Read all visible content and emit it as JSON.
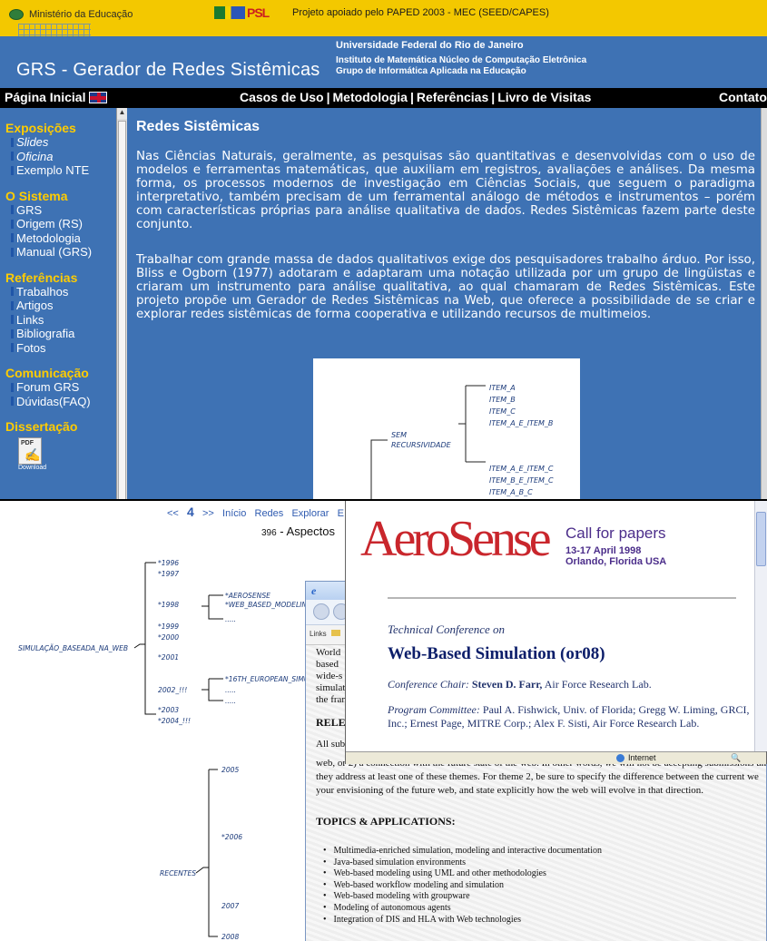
{
  "top": {
    "gov_left": "Ministério da Educação",
    "psl_logo": "PSL",
    "project": "Projeto apoiado pelo PAPED 2003 - MEC (SEED/CAPES)",
    "site_title": "GRS - Gerador de Redes Sistêmicas",
    "university": "Universidade Federal do Rio de Janeiro",
    "institute_line1": "Instituto de Matemática  Núcleo de Computação Eletrônica",
    "institute_line2": "Grupo de Informática Aplicada na Educação",
    "nav": {
      "home": "Página Inicial",
      "links": [
        "Casos de Uso",
        "Metodologia",
        "Referências",
        "Livro de Visitas"
      ],
      "contact": "Contato"
    },
    "sidebar": {
      "sections": [
        {
          "title": "Exposições",
          "items": [
            "Slides",
            "Oficina",
            "Exemplo NTE"
          ]
        },
        {
          "title": "O Sistema",
          "items": [
            "GRS",
            "Origem (RS)",
            "Metodologia",
            "Manual (GRS)"
          ]
        },
        {
          "title": "Referências",
          "items": [
            "Trabalhos",
            "Artigos",
            "Links",
            "Bibliografia",
            "Fotos"
          ]
        },
        {
          "title": "Comunicação",
          "items": [
            "Forum GRS",
            "Dúvidas(FAQ)"
          ]
        },
        {
          "title": "Dissertação",
          "items": []
        }
      ],
      "pdf_label": "PDF",
      "pdf_caption": "Download"
    },
    "content": {
      "heading": "Redes Sistêmicas",
      "para1": "Nas Ciências Naturais, geralmente, as pesquisas são quantitativas e desenvolvidas com o uso de modelos e ferramentas matemáticas, que auxiliam em registros, avaliações e análises.  Da mesma forma, os processos modernos de investigação em Ciências Sociais, que seguem o paradigma interpretativo, também precisam de um  ferramental análogo de métodos e instrumentos – porém com características próprias para análise qualitativa de dados.  Redes Sistêmicas  fazem parte deste conjunto.",
      "para2": "Trabalhar com grande massa de dados qualitativos exige dos pesquisadores trabalho árduo.  Por isso,  Bliss e Ogborn (1977) adotaram e adaptaram uma notação utilizada por um grupo de lingüistas e criaram um instrumento para análise qualitativa, ao qual chamaram de Redes Sistêmicas.  Este projeto propõe um Gerador de Redes Sistêmicas na Web, que oferece a possibilidade de se criar e explorar redes sistêmicas de forma cooperativa e utilizando recursos de multimeios.",
      "diagram": {
        "root": "SEM RECURSIVIDADE",
        "group1": [
          "ITEM_A",
          "ITEM_B",
          "ITEM_C",
          "ITEM_A_E_ITEM_B"
        ],
        "group2": [
          "ITEM_A_E_ITEM_C",
          "ITEM_B_E_ITEM_C",
          "ITEM_A_B_C"
        ]
      }
    }
  },
  "bottom": {
    "nav": {
      "prev": "<<",
      "page": "4",
      "next": ">>",
      "links": [
        "Início",
        "Redes",
        "Explorar",
        "E"
      ]
    },
    "aspect_page": "396",
    "aspect_title": "Aspectos",
    "tree": {
      "root": "SIMULAÇÃO_BASEADA_NA_WEB",
      "years": [
        "*1996",
        "*1997",
        "*1998",
        "*1999",
        "*2000",
        "*2001",
        "2002_!!!",
        "*2003",
        "*2004_!!!"
      ],
      "sub1998": [
        "*AEROSENSE",
        "*WEB_BASED_MODELIN",
        "....."
      ],
      "sub2002": [
        "*16TH_EUROPEAN_SIMU",
        ".....",
        "....."
      ],
      "recent_label": "RECENTES",
      "recent_years": [
        "2005",
        "*2006",
        "2007",
        "2008"
      ]
    },
    "ie_window": {
      "links_label": "Links",
      "text_frag": [
        "World",
        "based",
        "wide-s",
        "simulat",
        "the fran"
      ],
      "heading_rel": "RELE",
      "all_sub": "All sub",
      "paragraph": "web, or 2) a connection with the future state of the web. In other words, we will not be accepting submissions un they address at least one of these themes. For theme 2, be sure to specify the difference between the current we your envisioning of the future web, and state explicitly how the web will evolve in that direction.",
      "topics_heading": "TOPICS & APPLICATIONS:",
      "topics": [
        "Multimedia-enriched simulation, modeling and interactive documentation",
        "Java-based simulation environments",
        "Web-based modeling using UML and other methodologies",
        "Web-based workflow modeling and simulation",
        "Web-based modeling with groupware",
        "Modeling of autonomous agents",
        "Integration of DIS and HLA with Web technologies"
      ]
    },
    "aerosense": {
      "logo": "AeroSense",
      "cfp": "Call for papers",
      "dates": "13-17 April 1998",
      "place": "Orlando, Florida USA",
      "technical": "Technical Conference on",
      "title": "Web-Based Simulation (or08)",
      "chair_label": "Conference Chair:",
      "chair_name": "Steven D. Farr,",
      "chair_org": "Air Force Research Lab.",
      "pc_label": "Program Committee:",
      "pc_text": "Paul A. Fishwick, Univ. of Florida; Gregg W. Liming, GRCI, Inc.; Ernest Page, MITRE Corp.; Alex F. Sisti, Air Force Research Lab.",
      "status": "Internet"
    }
  }
}
